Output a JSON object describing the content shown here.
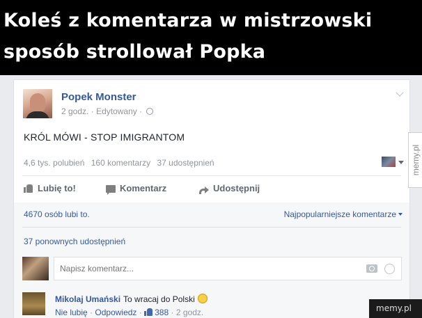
{
  "meme": {
    "title_line1": "Koleś z komentarza w mistrzowski",
    "title_line2": "sposób strollował Popka"
  },
  "post": {
    "page_name": "Popek Monster",
    "time": "2 godz.",
    "edited": "Edytowany",
    "separator": "·",
    "text": "KRÓL MÓWI - STOP IMIGRANTOM",
    "likes_count": "4,6 tys. polubień",
    "comments_count": "160 komentarzy",
    "shares_count": "37 udostępnień"
  },
  "actions": {
    "like": "Lubię to!",
    "comment": "Komentarz",
    "share": "Udostępnij"
  },
  "social": {
    "likes_text": "4670 osób lubi to.",
    "sort_label": "Najpopularniejsze komentarze",
    "reshares": "37 ponownych udostępnień"
  },
  "composer": {
    "placeholder": "Napisz komentarz..."
  },
  "comment": {
    "author": "Mikolaj Umański",
    "text": "To wracaj do Polski",
    "unlike": "Nie lubię",
    "reply": "Odpowiedz",
    "likes": "388",
    "time": "2 godz.",
    "dot": "·"
  },
  "watermarks": {
    "side": "memy.pl",
    "corner": "memy.pl"
  }
}
